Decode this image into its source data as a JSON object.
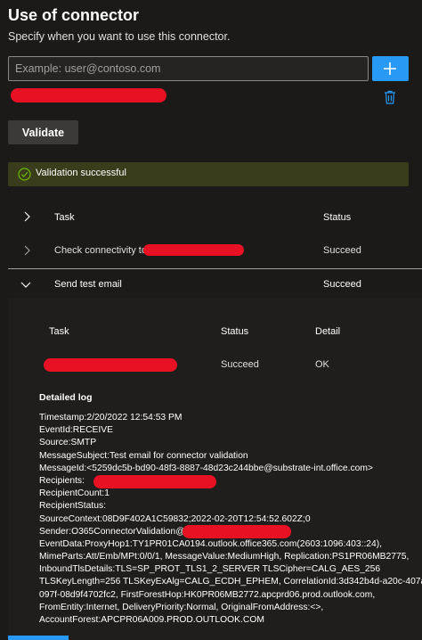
{
  "header": {
    "title": "Use of connector",
    "subtitle": "Specify when you want to use this connector."
  },
  "email_input": {
    "placeholder": "Example: user@contoso.com",
    "value": ""
  },
  "icons": {
    "add": "plus-icon",
    "delete": "trash-icon",
    "success": "check-circle-icon",
    "expand": "chevron-right-icon",
    "collapse": "chevron-down-icon"
  },
  "colors": {
    "accent": "#2899f5",
    "success_bg": "#393d1b",
    "success_icon": "#6bb700",
    "redaction": "#e81123"
  },
  "validate_label": "Validate",
  "status_message": "Validation successful",
  "results_table": {
    "headers": {
      "task": "Task",
      "status": "Status"
    },
    "rows": [
      {
        "task": "Check connectivity to",
        "status": "Succeed",
        "expanded": false
      },
      {
        "task": "Send test email",
        "status": "Succeed",
        "expanded": true
      }
    ]
  },
  "detail_table": {
    "headers": {
      "task": "Task",
      "status": "Status",
      "detail": "Detail"
    },
    "row": {
      "status": "Succeed",
      "detail": "OK"
    }
  },
  "detailed_log": {
    "title": "Detailed log",
    "lines": [
      "Timestamp:2/20/2022 12:54:53 PM",
      "EventId:RECEIVE",
      "Source:SMTP",
      "MessageSubject:Test email for connector validation",
      "MessageId:<5259dc5b-bd90-48f3-8887-48d23c244bbe@substrate-int.office.com>",
      "Recipients:",
      "RecipientCount:1",
      "RecipientStatus:",
      "SourceContext:08D9F402A1C59832;2022-02-20T12:54:52.602Z;0",
      "Sender:O365ConnectorValidation@",
      "EventData:ProxyHop1:TY1PR01CA0194.outlook.office365.com(2603:1096:403::24),",
      "MimeParts:Att/Emb/MPt:0/0/1, MessageValue:MediumHigh, Replication:PS1PR06MB2775,",
      "InboundTlsDetails:TLS=SP_PROT_TLS1_2_SERVER TLSCipher=CALG_AES_256",
      "TLSKeyLength=256 TLSKeyExAlg=CALG_ECDH_EPHEM, CorrelationId:3d342b4d-a20c-407a-",
      "097f-08d9f4702fc2, FirstForestHop:HK0PR06MB2772.apcprd06.prod.outlook.com,",
      "FromEntity:Internet, DeliveryPriority:Normal, OriginalFromAddress:<>,",
      "AccountForest:APCPR06A009.PROD.OUTLOOK.COM"
    ]
  }
}
